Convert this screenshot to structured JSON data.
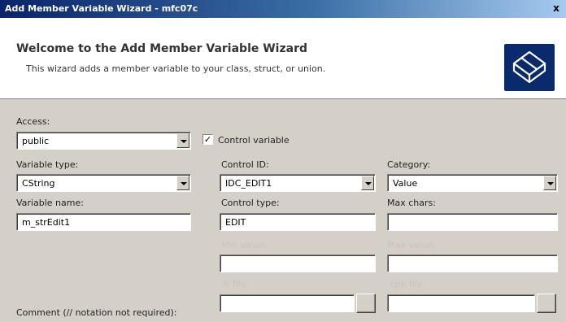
{
  "window": {
    "title": "Add Member Variable Wizard - mfc07c",
    "close_glyph": "x"
  },
  "header": {
    "title": "Welcome to the Add Member Variable Wizard",
    "subtitle": "This wizard adds a member variable to your class, struct, or union.",
    "logo_icon": "wizard-logo-icon"
  },
  "form": {
    "access": {
      "label": "Access:",
      "value": "public"
    },
    "control_variable": {
      "label": "Control variable",
      "checked": true,
      "mark": "✓"
    },
    "variable_type": {
      "label": "Variable type:",
      "value": "CString"
    },
    "control_id": {
      "label": "Control ID:",
      "value": "IDC_EDIT1"
    },
    "category": {
      "label": "Category:",
      "value": "Value"
    },
    "variable_name": {
      "label": "Variable name:",
      "value": "m_strEdit1"
    },
    "control_type": {
      "label": "Control type:",
      "value": "EDIT"
    },
    "max_chars": {
      "label": "Max chars:",
      "value": ""
    },
    "min_value": {
      "label": "Min value:",
      "value": ""
    },
    "max_value": {
      "label": "Max value:",
      "value": ""
    },
    "h_file": {
      "label": ".h file:",
      "value": ""
    },
    "cpp_file": {
      "label": ".cpp file:",
      "value": ""
    },
    "comment": {
      "label": "Comment (// notation not required):"
    }
  }
}
